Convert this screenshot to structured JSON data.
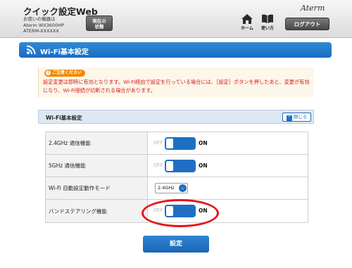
{
  "header": {
    "app_title": "クイック設定Web",
    "device_caption": "お使いの機器は",
    "model": "Aterm WX3600HP",
    "device_name": "ATERM-XXXXXX",
    "status_button_line1": "現在の",
    "status_button_line2": "状態",
    "brand": "Aterm",
    "home_label": "ホーム",
    "manual_label": "使い方",
    "logout_label": "ログアウト"
  },
  "page": {
    "title": "Wi-Fi基本設定",
    "icon": "wifi-icon"
  },
  "notice": {
    "badge": "ご注意ください",
    "text": "設定変更は即時に有効となります。Wi-Fi経由で設定を行っている場合には、［設定］ボタンを押したあと、変更が有効になり、Wi-Fi接続が切断される場合があります。"
  },
  "panel": {
    "title": "Wi-Fi基本設定",
    "close_label": "閉じる"
  },
  "settings": [
    {
      "label": "2.4GHz 通信機能",
      "type": "toggle",
      "off_label": "OFF",
      "on_label": "ON",
      "state": "on"
    },
    {
      "label": "5GHz 通信機能",
      "type": "toggle",
      "off_label": "OFF",
      "on_label": "ON",
      "state": "on"
    },
    {
      "label": "Wi-Fi 自動設定動作モード",
      "type": "select",
      "value": "2.4GHz"
    },
    {
      "label": "バンドステアリング機能",
      "type": "toggle",
      "off_label": "OFF",
      "on_label": "ON",
      "state": "on"
    }
  ],
  "submit_label": "設定",
  "colors": {
    "accent": "#1e6fc4",
    "notice_red": "#d3231b",
    "badge_orange": "#f08a00",
    "highlight_red": "#e6141b"
  }
}
